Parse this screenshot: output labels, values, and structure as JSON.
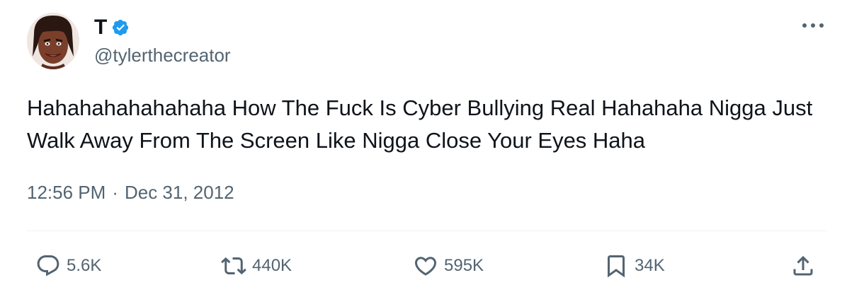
{
  "author": {
    "display_name": "T",
    "handle": "@tylerthecreator",
    "verified": true,
    "verified_color": "#1d9bf0"
  },
  "tweet": {
    "text": "Hahahahahahahaha How The Fuck Is Cyber Bullying Real Hahahaha Nigga Just Walk Away From The Screen Like Nigga Close Your Eyes Haha",
    "time": "12:56 PM",
    "separator": "·",
    "date": "Dec 31, 2012"
  },
  "actions": {
    "reply": {
      "icon": "reply-icon",
      "count": "5.6K"
    },
    "retweet": {
      "icon": "retweet-icon",
      "count": "440K"
    },
    "like": {
      "icon": "heart-icon",
      "count": "595K"
    },
    "bookmark": {
      "icon": "bookmark-icon",
      "count": "34K"
    },
    "share": {
      "icon": "share-icon"
    }
  },
  "menu": {
    "icon": "more-icon"
  }
}
